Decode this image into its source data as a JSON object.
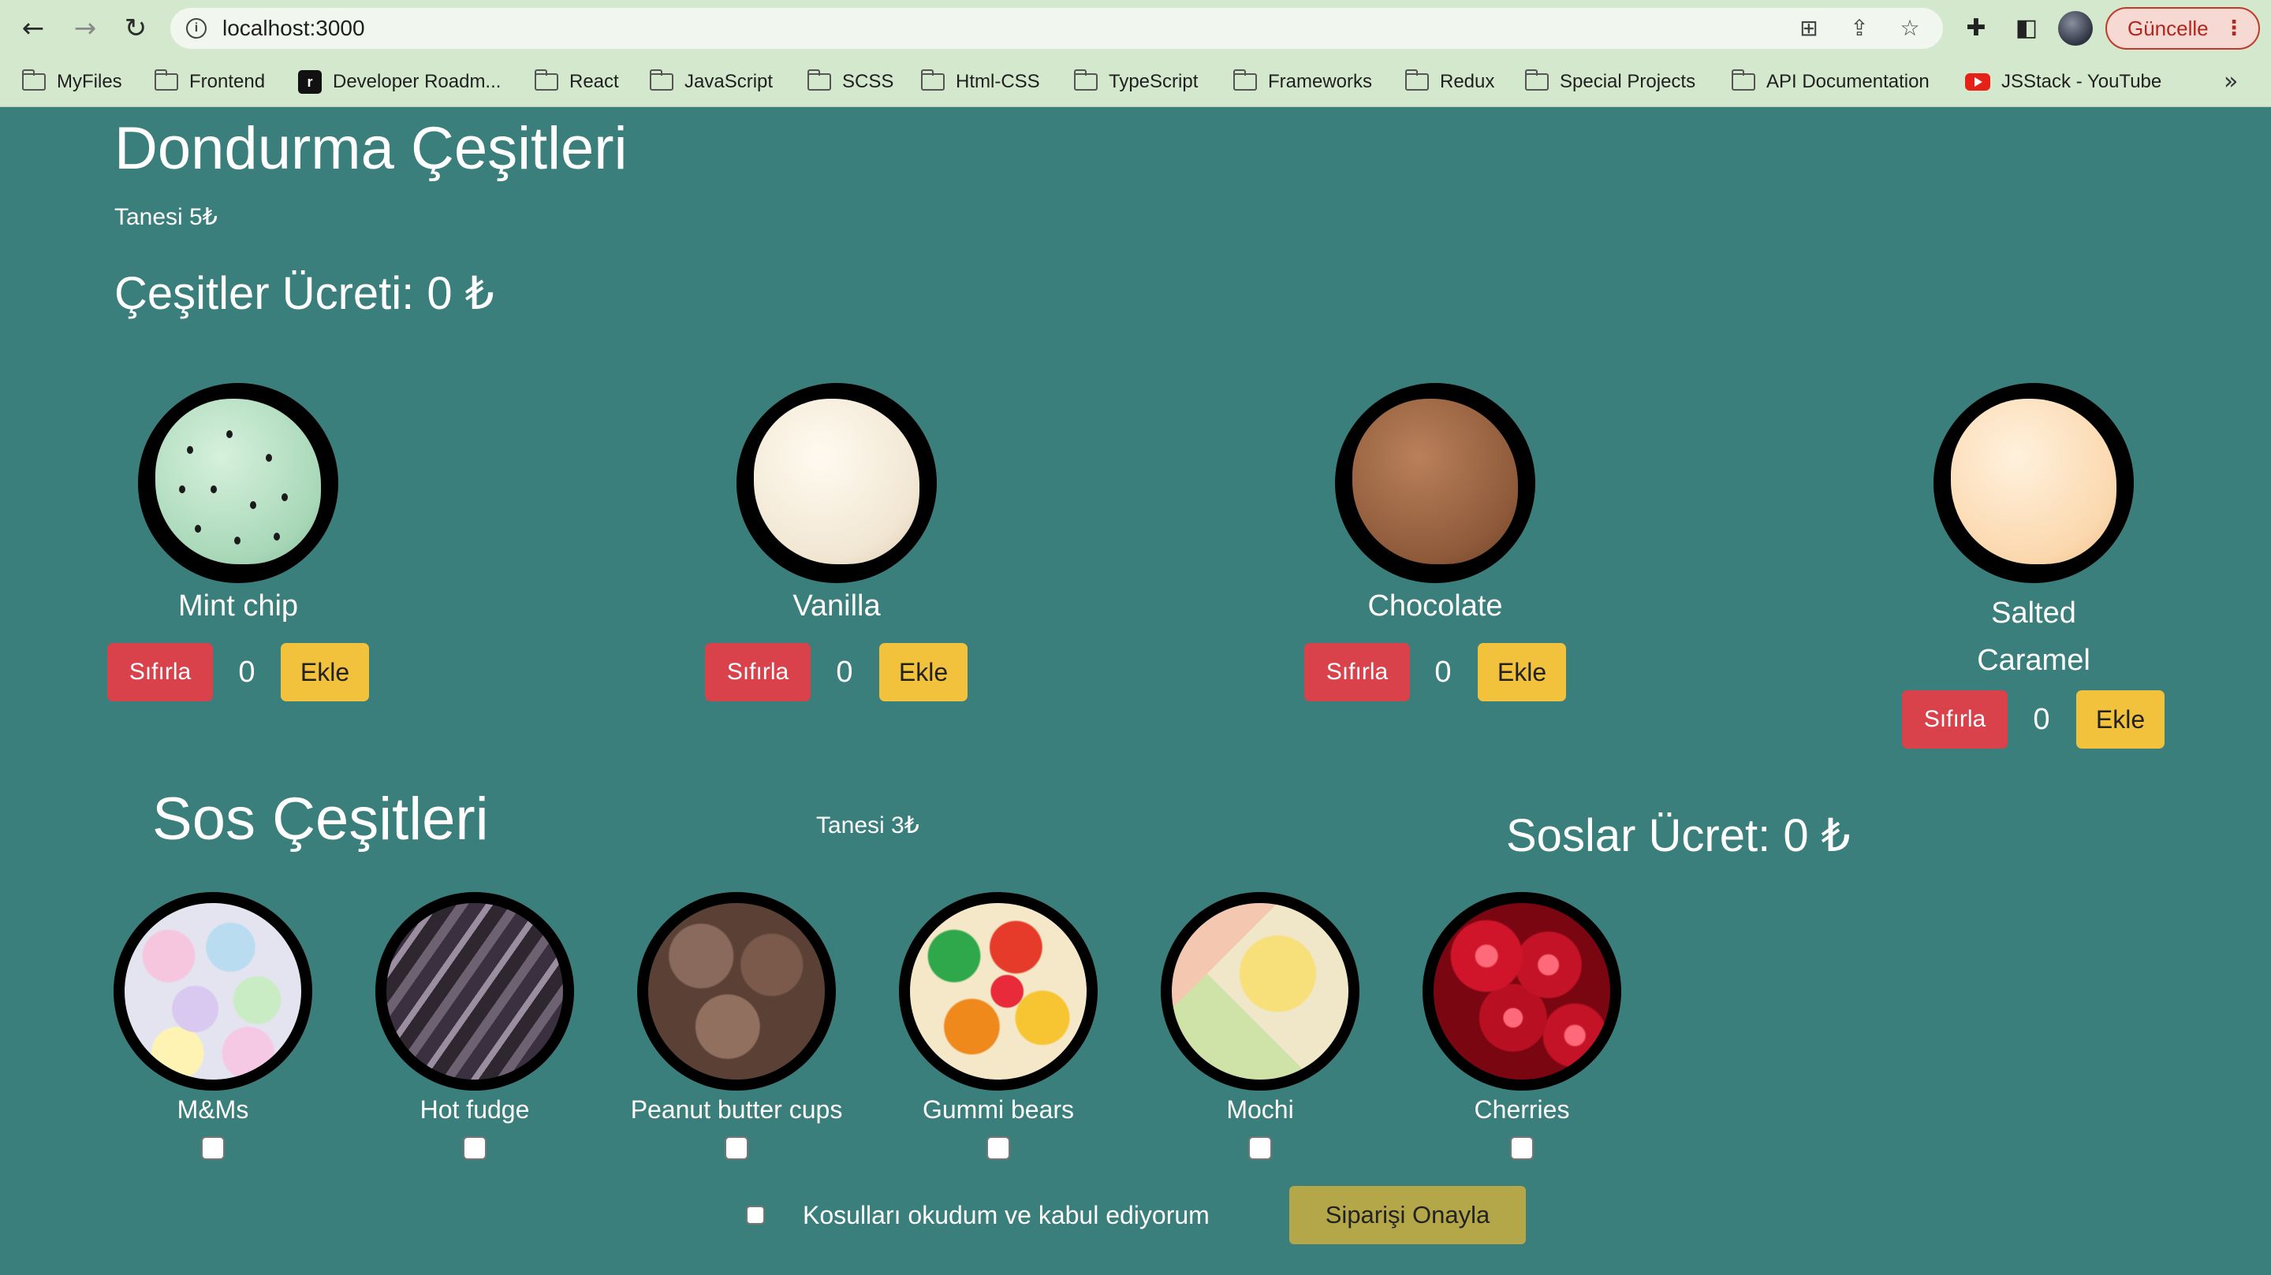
{
  "browser": {
    "url": "localhost:3000",
    "update_label": "Güncelle",
    "bookmarks": [
      {
        "label": "MyFiles",
        "icon": "folder-icon"
      },
      {
        "label": "Frontend",
        "icon": "folder-icon"
      },
      {
        "label": "Developer Roadm...",
        "icon": "roadmap-icon"
      },
      {
        "label": "React",
        "icon": "folder-icon"
      },
      {
        "label": "JavaScript",
        "icon": "folder-icon"
      },
      {
        "label": "SCSS",
        "icon": "folder-icon"
      },
      {
        "label": "Html-CSS",
        "icon": "folder-icon"
      },
      {
        "label": "TypeScript",
        "icon": "folder-icon"
      },
      {
        "label": "Frameworks",
        "icon": "folder-icon"
      },
      {
        "label": "Redux",
        "icon": "folder-icon"
      },
      {
        "label": "Special Projects",
        "icon": "folder-icon"
      },
      {
        "label": "API Documentation",
        "icon": "folder-icon"
      },
      {
        "label": "JSStack - YouTube",
        "icon": "youtube-icon"
      }
    ],
    "update_color": "#b3261e"
  },
  "scoops": {
    "title": "Dondurma Çeşitleri",
    "unit_price": "Tanesi 5₺",
    "total": "Çeşitler Ücreti: 0 ₺",
    "reset_label": "Sıfırla",
    "add_label": "Ekle",
    "items": [
      {
        "name": "Mint chip",
        "count": "0"
      },
      {
        "name": "Vanilla",
        "count": "0"
      },
      {
        "name": "Chocolate",
        "count": "0"
      },
      {
        "name": "Salted Caramel",
        "count": "0"
      }
    ],
    "reset_color": "#d9414b",
    "add_color": "#f3c23c"
  },
  "toppings": {
    "title": "Sos Çeşitleri",
    "unit_price": "Tanesi 3₺",
    "total": "Soslar Ücret: 0 ₺",
    "items": [
      {
        "name": "M&Ms"
      },
      {
        "name": "Hot fudge"
      },
      {
        "name": "Peanut butter cups"
      },
      {
        "name": "Gummi bears"
      },
      {
        "name": "Mochi"
      },
      {
        "name": "Cherries"
      }
    ]
  },
  "order": {
    "terms_label": "Kosulları okudum ve kabul ediyorum",
    "submit_label": "Siparişi Onayla",
    "submit_color": "#b4a74a"
  },
  "page": {
    "background": "#3a7f7c"
  }
}
